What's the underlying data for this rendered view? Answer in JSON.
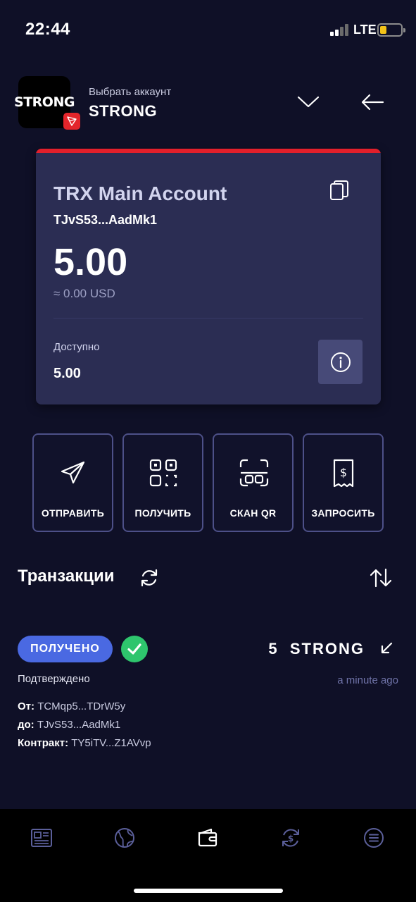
{
  "status_bar": {
    "time": "22:44",
    "network": "LTE"
  },
  "header": {
    "logo_text": "STRONG",
    "select_account_label": "Выбрать аккаунт",
    "account_name": "STRONG"
  },
  "card": {
    "title": "TRX Main Account",
    "address": "TJvS53...AadMk1",
    "balance": "5.00",
    "usd_value": "≈ 0.00 USD",
    "available_label": "Доступно",
    "available_value": "5.00"
  },
  "actions": [
    {
      "label": "ОТПРАВИТЬ",
      "icon": "send-icon"
    },
    {
      "label": "ПОЛУЧИТЬ",
      "icon": "qr-code-icon"
    },
    {
      "label": "СКАН QR",
      "icon": "scan-qr-icon"
    },
    {
      "label": "ЗАПРОСИТЬ",
      "icon": "request-receipt-icon"
    }
  ],
  "transactions": {
    "title": "Транзакции",
    "items": [
      {
        "type_badge": "ПОЛУЧЕНО",
        "amount": "5  STRONG",
        "status": "Подтверждено",
        "time_ago": "a minute ago",
        "from_label": "От:",
        "from": "TCMqp5...TDrW5y",
        "to_label": "до:",
        "to": "TJvS53...AadMk1",
        "contract_label": "Контракт:",
        "contract": "TY5iTV...Z1AVvp"
      }
    ]
  },
  "bottom_nav": [
    {
      "icon": "news-icon"
    },
    {
      "icon": "globe-icon"
    },
    {
      "icon": "wallet-icon",
      "active": true
    },
    {
      "icon": "exchange-icon"
    },
    {
      "icon": "menu-icon"
    }
  ],
  "colors": {
    "background": "#0f1027",
    "card": "#2b2d53",
    "card_accent": "#e21f2b",
    "badge": "#4a69e2",
    "success": "#2ec56d",
    "battery": "#f2c218"
  }
}
